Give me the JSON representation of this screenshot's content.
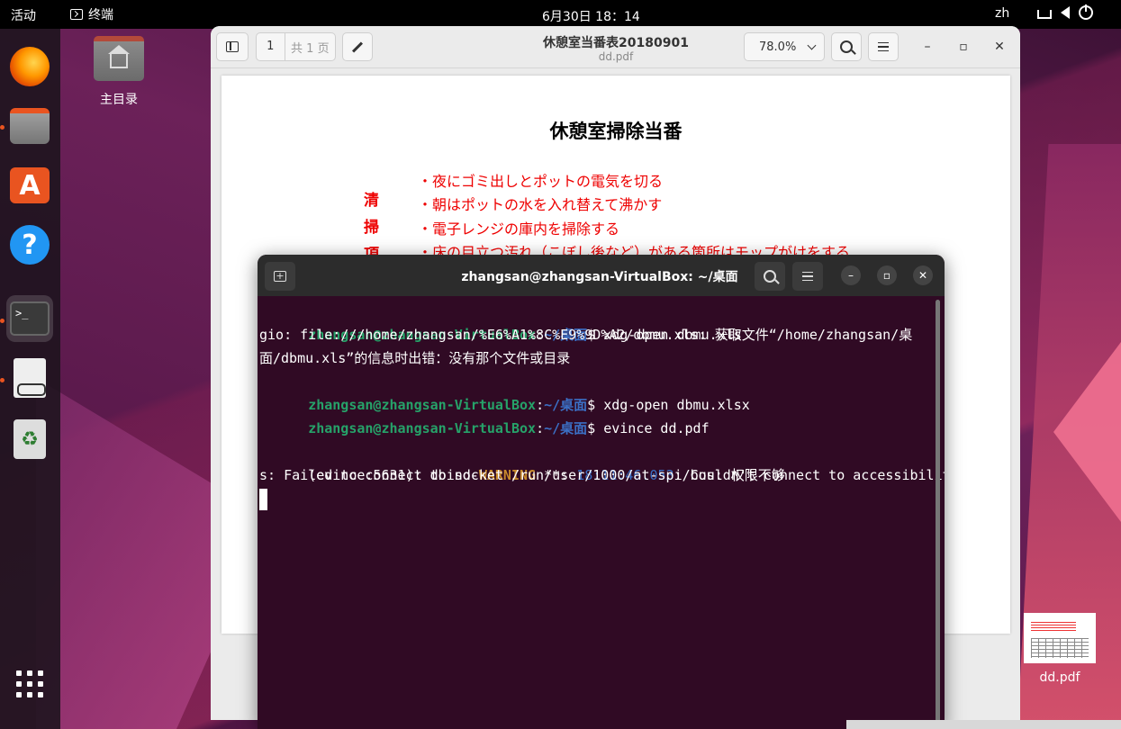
{
  "topbar": {
    "activities": "活动",
    "app_name": "终端",
    "clock": "6月30日  18：14",
    "lang": "zh"
  },
  "dock": {
    "items": [
      "firefox",
      "files",
      "app-center",
      "help",
      "terminal",
      "document-viewer",
      "trash",
      "show-apps"
    ]
  },
  "desktop": {
    "home_label": "主目录",
    "pdf_label": "dd.pdf"
  },
  "evince": {
    "page_current": "1",
    "page_of": "共 1 页",
    "title": "休憩室当番表20180901",
    "subtitle": "dd.pdf",
    "zoom": "78.0%",
    "doc": {
      "title": "休憩室掃除当番",
      "side_chars": [
        "清",
        "掃",
        "項"
      ],
      "lines": [
        "・夜にゴミ出しとポットの電気を切る",
        "・朝はポットの水を入れ替えて沸かす",
        "・電子レンジの庫内を掃除する",
        "・床の目立つ汚れ（こぼし後など）がある箇所はモップがけをする"
      ]
    }
  },
  "terminal": {
    "title": "zhangsan@zhangsan-VirtualBox: ~/桌面",
    "prompt_user": "zhangsan@zhangsan-VirtualBox",
    "prompt_sep": ":",
    "prompt_path": "~/桌面",
    "prompt_dollar": "$",
    "lines": {
      "cmd1": " xdg-open dbmu.xls",
      "err1a": "gio: file:///home/zhangsan/%E6%A1%8C%E9%9D%A2/dbmu.xls: 获取文件“/home/zhangsan/桌",
      "err1b": "面/dbmu.xls”的信息时出错：没有那个文件或目录",
      "cmd2": " xdg-open dbmu.xlsx",
      "cmd3": " evince dd.pdf",
      "warn_pre": "(evince:5631): dbind-",
      "warn_word": "WARNING",
      "warn_mid": " **: ",
      "warn_ts": "18:11:46.053",
      "warn_post": ": Couldn't connect to accessibility bu",
      "warn2": "s: Failed to connect to socket /run/user/1000/at-spi/bus: 权限不够"
    }
  },
  "colors": {
    "terminal_bg": "#300a24",
    "prompt_user": "#26a269",
    "prompt_path": "#3b6fc4",
    "warning": "#c88a2c",
    "doc_red": "#e00000",
    "accent": "#e95420"
  }
}
